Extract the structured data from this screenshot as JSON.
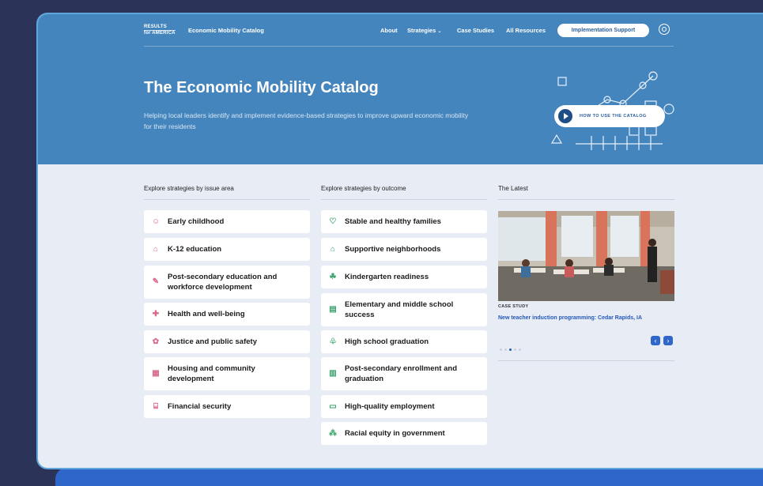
{
  "logo": {
    "line1": "RESULTS",
    "line2": "for AMERICA"
  },
  "nav": {
    "brand": "Economic Mobility Catalog",
    "links": [
      "About",
      "Strategies",
      "Case Studies",
      "All Resources"
    ],
    "strategies_caret": "⌄",
    "cta": "Implementation Support"
  },
  "hero": {
    "title": "The Economic Mobility Catalog",
    "subtitle": "Helping local leaders identify and implement evidence-based strategies to improve upward economic mobility for their residents",
    "how_to": "HOW TO USE THE CATALOG"
  },
  "issue": {
    "heading": "Explore strategies by issue area",
    "items": [
      {
        "label": "Early childhood",
        "icon": "baby-icon"
      },
      {
        "label": "K-12 education",
        "icon": "school-icon"
      },
      {
        "label": "Post-secondary education and workforce development",
        "icon": "graduation-icon"
      },
      {
        "label": "Health and well-being",
        "icon": "health-cross-icon"
      },
      {
        "label": "Justice and public safety",
        "icon": "justice-icon"
      },
      {
        "label": "Housing and community development",
        "icon": "building-icon"
      },
      {
        "label": "Financial security",
        "icon": "bank-icon"
      }
    ]
  },
  "outcome": {
    "heading": "Explore strategies by outcome",
    "items": [
      {
        "label": "Stable and healthy families",
        "icon": "heart-icon"
      },
      {
        "label": "Supportive neighborhoods",
        "icon": "neighborhood-icon"
      },
      {
        "label": "Kindergarten readiness",
        "icon": "child-icon"
      },
      {
        "label": "Elementary and middle school success",
        "icon": "book-icon"
      },
      {
        "label": "High school graduation",
        "icon": "cap-icon"
      },
      {
        "label": "Post-secondary enrollment and graduation",
        "icon": "document-icon"
      },
      {
        "label": "High-quality employment",
        "icon": "briefcase-icon"
      },
      {
        "label": "Racial equity in government",
        "icon": "people-icon"
      }
    ]
  },
  "latest": {
    "heading": "The Latest",
    "tag": "CASE STUDY",
    "title": "New teacher induction programming: Cedar Rapids, IA",
    "prev": "‹",
    "next": "›"
  }
}
